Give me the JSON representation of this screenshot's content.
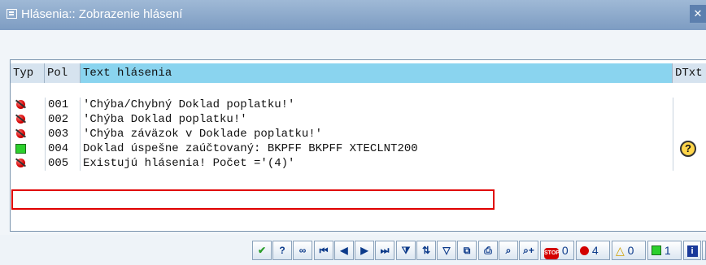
{
  "window": {
    "title": "Hlásenia:: Zobrazenie hlásení",
    "close_label": "✕"
  },
  "table": {
    "headers": {
      "typ": "Typ",
      "pol": "Pol",
      "text": "Text hlásenia",
      "dtxt": "DTxt"
    },
    "rows": [
      {
        "status": "error",
        "pol": "001",
        "text": "'Chýba/Chybný Doklad poplatku!'",
        "dtxt": ""
      },
      {
        "status": "error",
        "pol": "002",
        "text": "'Chýba Doklad poplatku!'",
        "dtxt": ""
      },
      {
        "status": "error",
        "pol": "003",
        "text": "'Chýba záväzok v Doklade poplatku!'",
        "dtxt": ""
      },
      {
        "status": "success",
        "pol": "004",
        "text": "Doklad úspešne zaúčtovaný: BKPFF BKPFF XTECLNT200",
        "dtxt": "?"
      },
      {
        "status": "error",
        "pol": "005",
        "text": "Existujú hlásenia! Počet ='(4)'",
        "dtxt": ""
      }
    ]
  },
  "toolbar": {
    "buttons": [
      {
        "name": "continue-button",
        "glyph": "✔"
      },
      {
        "name": "help-button",
        "glyph": "?"
      },
      {
        "name": "glasses-button",
        "glyph": "∞"
      },
      {
        "name": "first-page-button",
        "glyph": "⏮"
      },
      {
        "name": "prev-page-button",
        "glyph": "◀"
      },
      {
        "name": "next-page-button",
        "glyph": "▶"
      },
      {
        "name": "last-page-button",
        "glyph": "⏭"
      },
      {
        "name": "filter-button",
        "glyph": "⧩"
      },
      {
        "name": "sort-button",
        "glyph": "⇅"
      },
      {
        "name": "filter2-button",
        "glyph": "▽"
      },
      {
        "name": "copy-button",
        "glyph": "⧉"
      },
      {
        "name": "print-button",
        "glyph": "⎙"
      },
      {
        "name": "find-button",
        "glyph": "⌕"
      },
      {
        "name": "find-next-button",
        "glyph": "⌕+"
      }
    ],
    "counts": {
      "stop": "0",
      "error": "4",
      "warning": "0",
      "success": "1"
    },
    "stop_label": "STOP"
  },
  "colors": {
    "title_bar": "#8aa8cc",
    "header_selected": "#8ad4ef",
    "error": "#d30000",
    "success": "#2ccf2c",
    "highlight_box": "#e00000"
  }
}
